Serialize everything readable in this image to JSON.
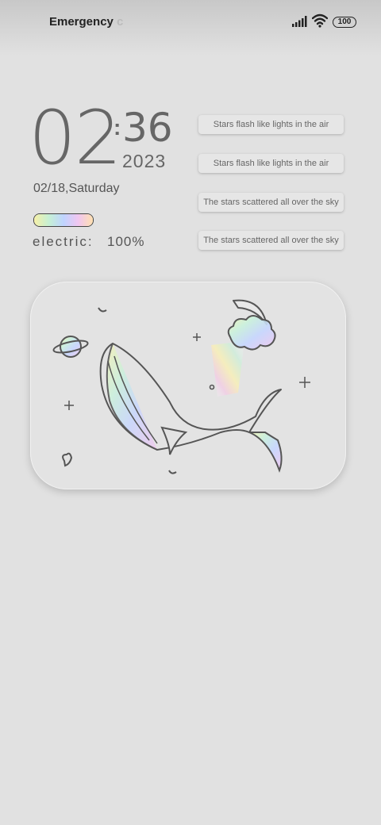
{
  "status_bar": {
    "carrier": "Emergency",
    "carrier_fade": "c",
    "battery_level": "100"
  },
  "clock": {
    "hour": "02",
    "colon": ":",
    "minute": "36",
    "year": "2023",
    "date": "02/18,Saturday"
  },
  "battery": {
    "label": "electric:",
    "value": "100%",
    "fill_percent": 100
  },
  "quotes": [
    "Stars flash like lights in the air",
    "Stars flash like lights in the air",
    "The stars scattered all over the sky",
    "The stars scattered all over the sky"
  ],
  "widget": {
    "illustration": "whale-moon-planet-illustration"
  },
  "colors": {
    "background": "#e1e1e1",
    "text": "#666666",
    "line_art": "#555555"
  }
}
